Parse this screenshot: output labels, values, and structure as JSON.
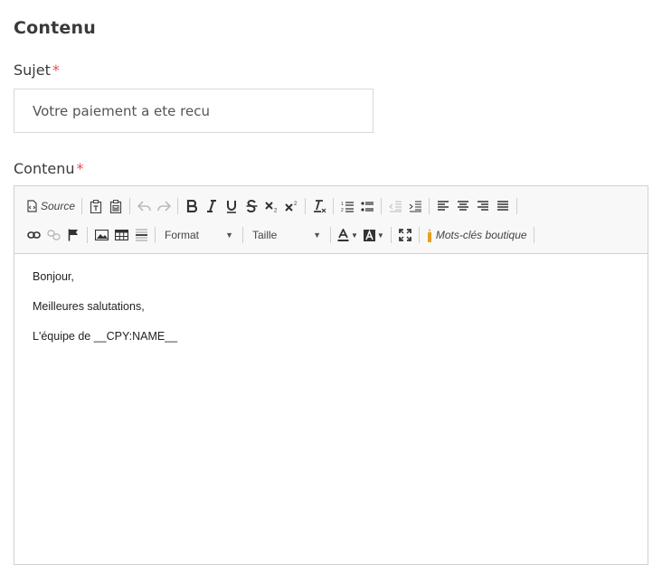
{
  "section_title": "Contenu",
  "subject": {
    "label": "Sujet",
    "required_mark": "*",
    "value": "Votre paiement a ete recu"
  },
  "content": {
    "label": "Contenu",
    "required_mark": "*"
  },
  "toolbar": {
    "source_label": "Source",
    "format_label": "Format",
    "size_label": "Taille",
    "shop_keywords_label": "Mots-clés boutique"
  },
  "editor_body": {
    "lines": [
      "Bonjour,",
      "Meilleures salutations,",
      "L'équipe de __CPY:NAME__"
    ]
  },
  "colors": {
    "required": "#e05050",
    "keyword_icon": "#e8a020"
  }
}
